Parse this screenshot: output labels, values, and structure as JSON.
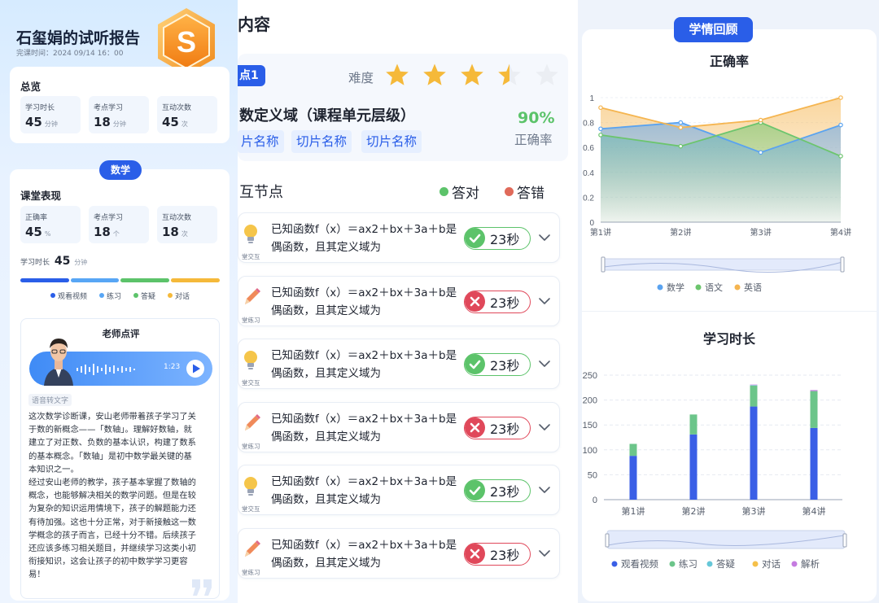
{
  "report": {
    "title": "石玺娟的试听报告",
    "class_time": "完课时间：2024 09/14 16：00",
    "badge_letter": "S"
  },
  "overview": {
    "title": "总览",
    "stats": [
      {
        "label": "学习时长",
        "value": "45",
        "unit": "分钟"
      },
      {
        "label": "考点学习",
        "value": "18",
        "unit": "分钟"
      },
      {
        "label": "互动次数",
        "value": "45",
        "unit": "次"
      }
    ]
  },
  "subject_tag": "数学",
  "classroom": {
    "title": "课堂表现",
    "stats": [
      {
        "label": "正确率",
        "value": "45",
        "unit": "%"
      },
      {
        "label": "考点学习",
        "value": "18",
        "unit": "个"
      },
      {
        "label": "互动次数",
        "value": "18",
        "unit": "次"
      }
    ],
    "duration_label": "学习时长",
    "duration_value": "45",
    "duration_unit": "分钟",
    "legend": [
      {
        "name": "观看视频",
        "color": "#2a5ee8"
      },
      {
        "name": "练习",
        "color": "#58a6f5"
      },
      {
        "name": "答疑",
        "color": "#5cc36a"
      },
      {
        "name": "对话",
        "color": "#f5b93a"
      }
    ]
  },
  "teacher_review": {
    "title": "老师点评",
    "audio_time": "1:23",
    "speech_to_text": "语音转文字",
    "lines": [
      "这次数学诊断课，安山老师带着孩子学习了关",
      "于数的新概念——「数轴」。理解好数轴，就",
      "建立了对正数、负数的基本认识，构建了数系",
      "的基本概念。「数轴」是初中数学最关键的基",
      "本知识之一。",
      "经过安山老师的教学，孩子基本掌握了数轴的",
      "概念，也能够解决相关的数学问题。但是在较",
      "为复杂的知识运用情境下，孩子的解题能力还",
      "有待加强。这也十分正常，对于新接触这一数",
      "学概念的孩子而言，已经十分不错。后续孩子",
      "还应该多练习相关题目，并继续学习这类小初",
      "衔接知识，这会让孩子的初中数学学习更容",
      "易！"
    ]
  },
  "content": {
    "title": "内容",
    "kp_tag": "点1",
    "difficulty_label": "难度",
    "difficulty_stars": 3.5,
    "kp_name": "数定义域（课程单元层级）",
    "accuracy_value": "90%",
    "accuracy_label": "正确率",
    "chips": [
      "片名称",
      "切片名称",
      "切片名称"
    ],
    "interaction_title": "互节点",
    "legend_correct": "答对",
    "legend_wrong": "答错",
    "questions": [
      {
        "type_label": "堂交互",
        "icon": "bulb-icon",
        "line1": "已知函数f（x）＝ax2＋bx＋3a＋b是",
        "line2": "偶函数，且其定义域为",
        "correct": true,
        "time": "23秒"
      },
      {
        "type_label": "堂练习",
        "icon": "pencil-icon",
        "line1": "已知函数f（x）＝ax2＋bx＋3a＋b是",
        "line2": "偶函数，且其定义域为",
        "correct": false,
        "time": "23秒"
      },
      {
        "type_label": "堂交互",
        "icon": "bulb-icon",
        "line1": "已知函数f（x）＝ax2＋bx＋3a＋b是",
        "line2": "偶函数，且其定义域为",
        "correct": true,
        "time": "23秒"
      },
      {
        "type_label": "堂练习",
        "icon": "pencil-icon",
        "line1": "已知函数f（x）＝ax2＋bx＋3a＋b是",
        "line2": "偶函数，且其定义域为",
        "correct": false,
        "time": "23秒"
      },
      {
        "type_label": "堂交互",
        "icon": "bulb-icon",
        "line1": "已知函数f（x）＝ax2＋bx＋3a＋b是",
        "line2": "偶函数，且其定义域为",
        "correct": true,
        "time": "23秒"
      },
      {
        "type_label": "堂练习",
        "icon": "pencil-icon",
        "line1": "已知函数f（x）＝ax2＋bx＋3a＋b是",
        "line2": "偶函数，且其定义域为",
        "correct": false,
        "time": "23秒"
      }
    ]
  },
  "review": {
    "tag": "学情回顾"
  },
  "chart_data": [
    {
      "type": "area",
      "title": "正确率",
      "categories": [
        "第1讲",
        "第2讲",
        "第3讲",
        "第4讲"
      ],
      "ylim": [
        0,
        1
      ],
      "yticks": [
        "0",
        "0.2",
        "0.4",
        "0.6",
        "0.8",
        "1"
      ],
      "series": [
        {
          "name": "数学",
          "color": "#5aa3f0",
          "values": [
            0.75,
            0.8,
            0.56,
            0.78
          ]
        },
        {
          "name": "语文",
          "color": "#6cc56d",
          "values": [
            0.7,
            0.61,
            0.8,
            0.53
          ]
        },
        {
          "name": "英语",
          "color": "#f5b550",
          "values": [
            0.92,
            0.76,
            0.82,
            1.0
          ]
        }
      ],
      "legend": "bottom"
    },
    {
      "type": "bar",
      "stacked": true,
      "title": "学习时长",
      "categories": [
        "第1讲",
        "第2讲",
        "第3讲",
        "第4讲"
      ],
      "ylim": [
        0,
        250
      ],
      "yticks": [
        "0",
        "50",
        "100",
        "150",
        "200",
        "250"
      ],
      "series": [
        {
          "name": "观看视频",
          "color": "#3a5fe6",
          "values": [
            88,
            131,
            187,
            144
          ]
        },
        {
          "name": "练习",
          "color": "#6cc58a",
          "values": [
            24,
            40,
            42,
            74
          ]
        },
        {
          "name": "答疑",
          "color": "#66c7d8",
          "values": [
            0,
            0,
            1,
            0
          ]
        },
        {
          "name": "对话",
          "color": "#f5c04a",
          "values": [
            0,
            0,
            0,
            0
          ]
        },
        {
          "name": "解析",
          "color": "#c57be0",
          "values": [
            0,
            0,
            1,
            2
          ]
        }
      ],
      "legend": "bottom"
    }
  ]
}
